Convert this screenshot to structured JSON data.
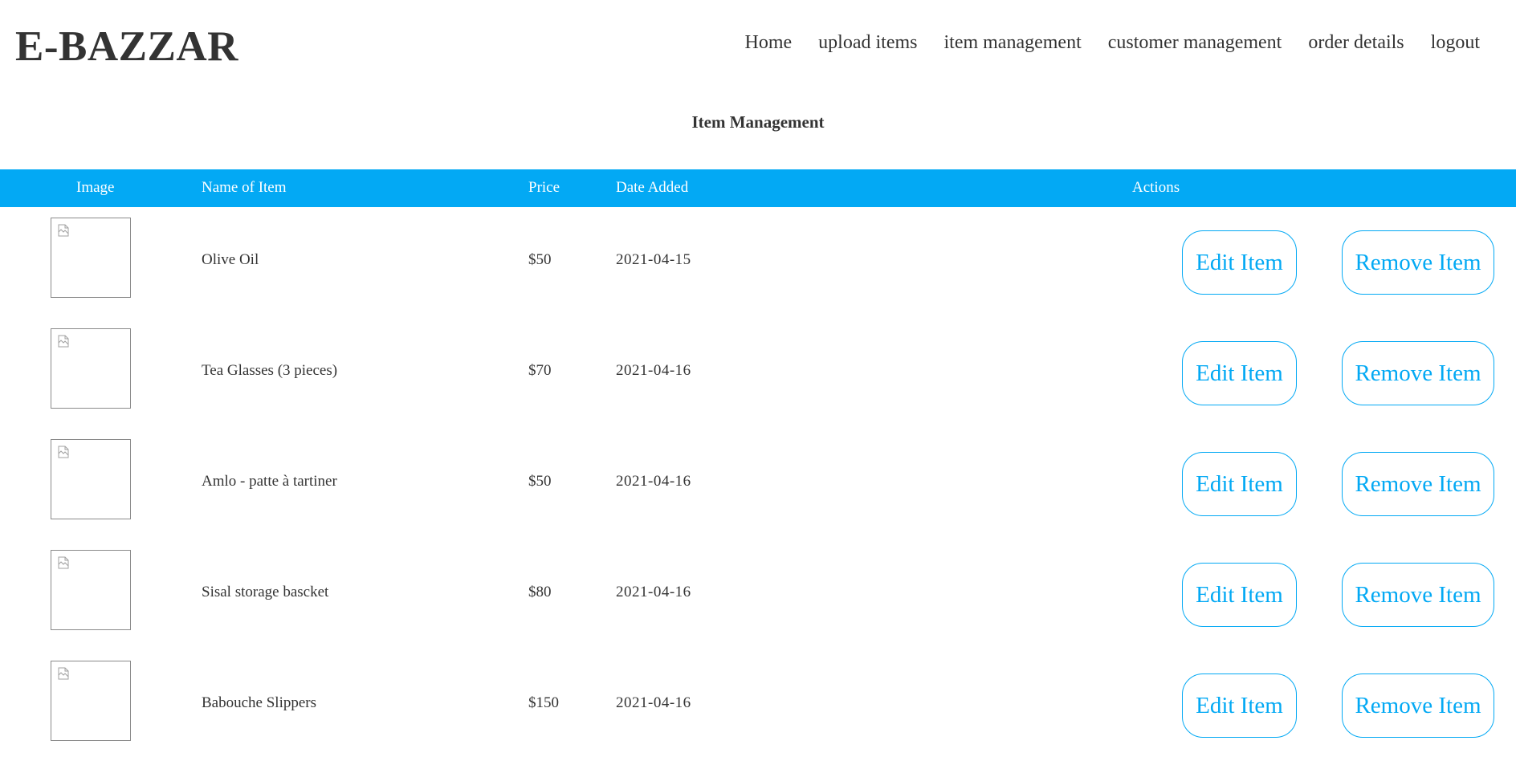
{
  "app": {
    "title": "E-BAZZAR"
  },
  "nav": {
    "items": [
      {
        "label": "Home"
      },
      {
        "label": "upload items"
      },
      {
        "label": "item management"
      },
      {
        "label": "customer management"
      },
      {
        "label": "order details"
      },
      {
        "label": "logout"
      }
    ]
  },
  "page": {
    "title": "Item Management"
  },
  "table": {
    "headers": {
      "image": "Image",
      "name": "Name of Item",
      "price": "Price",
      "date": "Date Added",
      "actions": "Actions"
    },
    "rows": [
      {
        "name": "Olive Oil",
        "price": "$50",
        "date": "2021-04-15",
        "edit": "Edit Item",
        "remove": "Remove Item",
        "image_icon": "broken-image-icon"
      },
      {
        "name": "Tea Glasses (3 pieces)",
        "price": "$70",
        "date": "2021-04-16",
        "edit": "Edit Item",
        "remove": "Remove Item",
        "image_icon": "broken-image-icon"
      },
      {
        "name": "Amlo - patte à tartiner",
        "price": "$50",
        "date": "2021-04-16",
        "edit": "Edit Item",
        "remove": "Remove Item",
        "image_icon": "broken-image-icon"
      },
      {
        "name": "Sisal storage bascket",
        "price": "$80",
        "date": "2021-04-16",
        "edit": "Edit Item",
        "remove": "Remove Item",
        "image_icon": "broken-image-icon"
      },
      {
        "name": "Babouche Slippers",
        "price": "$150",
        "date": "2021-04-16",
        "edit": "Edit Item",
        "remove": "Remove Item",
        "image_icon": "broken-image-icon"
      }
    ]
  },
  "colors": {
    "accent": "#03a9f4",
    "text": "#333333",
    "background": "#ffffff"
  }
}
